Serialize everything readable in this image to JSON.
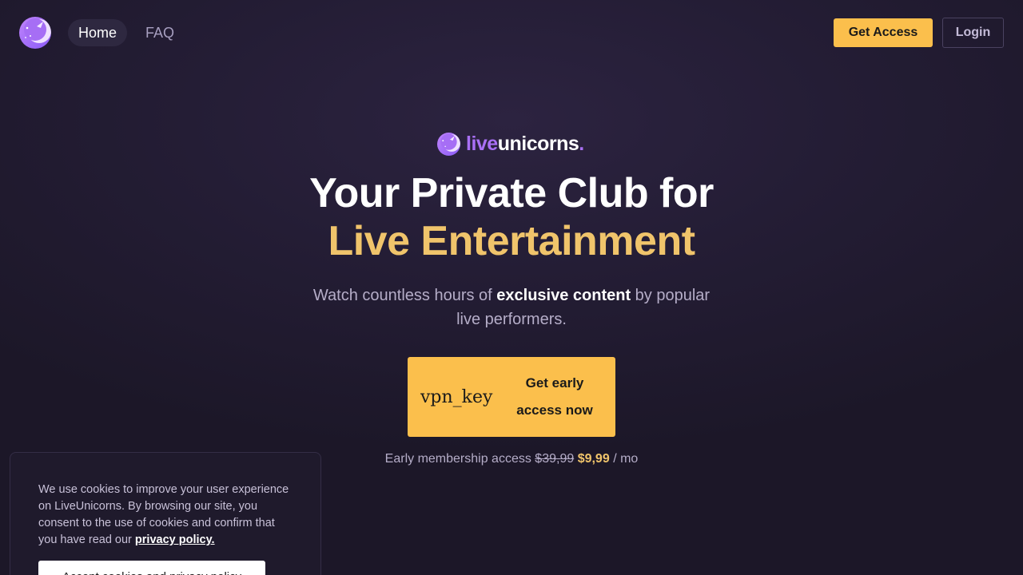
{
  "header": {
    "nav": {
      "home": "Home",
      "faq": "FAQ"
    },
    "get_access_label": "Get Access",
    "login_label": "Login"
  },
  "brand": {
    "live": "live",
    "unicorns": "unicorns",
    "period": "."
  },
  "hero": {
    "headline_line1": "Your Private Club for",
    "headline_line2": "Live Entertainment",
    "sub_before": "Watch countless hours of ",
    "sub_bold": "exclusive content",
    "sub_after": " by popular live performers."
  },
  "cta": {
    "icon_text": "vpn_key",
    "label": "Get early access now"
  },
  "pricing": {
    "label": "Early membership access",
    "old_price": "$39,99",
    "new_price": "$9,99",
    "period": "/ mo"
  },
  "cookie": {
    "text": "We use cookies to improve your user experience on LiveUnicorns. By browsing our site, you consent to the use of cookies and confirm that you have read our ",
    "link": "privacy policy.",
    "button": "Accept cookies and privacy policy"
  },
  "colors": {
    "accent_yellow": "#fbbf4c",
    "headline_gold": "#f0c46b",
    "brand_purple": "#a970f5",
    "background": "#241d35"
  },
  "icons": {
    "logo": "unicorn-moon-icon",
    "cta": "vpn-key-icon"
  }
}
